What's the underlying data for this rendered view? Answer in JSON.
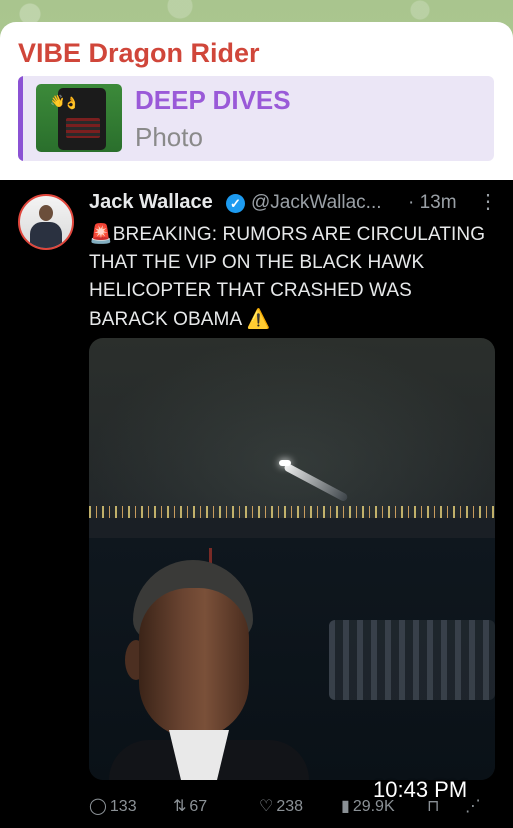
{
  "message": {
    "sender_name": "VIBE Dragon Rider",
    "reply": {
      "title": "DEEP DIVES",
      "subtitle": "Photo"
    },
    "timestamp": "10:43 PM"
  },
  "tweet": {
    "author_name": "Jack Wallace",
    "verified": true,
    "handle": "@JackWallac...",
    "time": "· 13m",
    "more_icon": "⋮",
    "text_emoji_start": "🚨",
    "text_body": "BREAKING: RUMORS ARE CIRCULATING THAT THE VIP ON THE BLACK HAWK HELICOPTER THAT CRASHED WAS BARACK OBAMA",
    "text_emoji_end": "⚠️",
    "stats": {
      "replies": "133",
      "retweets": "67",
      "likes": "238",
      "views": "29.9K"
    }
  },
  "icons": {
    "reply": "reply-icon",
    "retweet": "retweet-icon",
    "like": "heart-icon",
    "views": "views-icon",
    "bookmark": "bookmark-icon",
    "share": "share-icon"
  },
  "colors": {
    "sender": "#d0463a",
    "reply_accent": "#8b52d4",
    "verified": "#1d9bf0",
    "tweet_bg": "#000000"
  }
}
